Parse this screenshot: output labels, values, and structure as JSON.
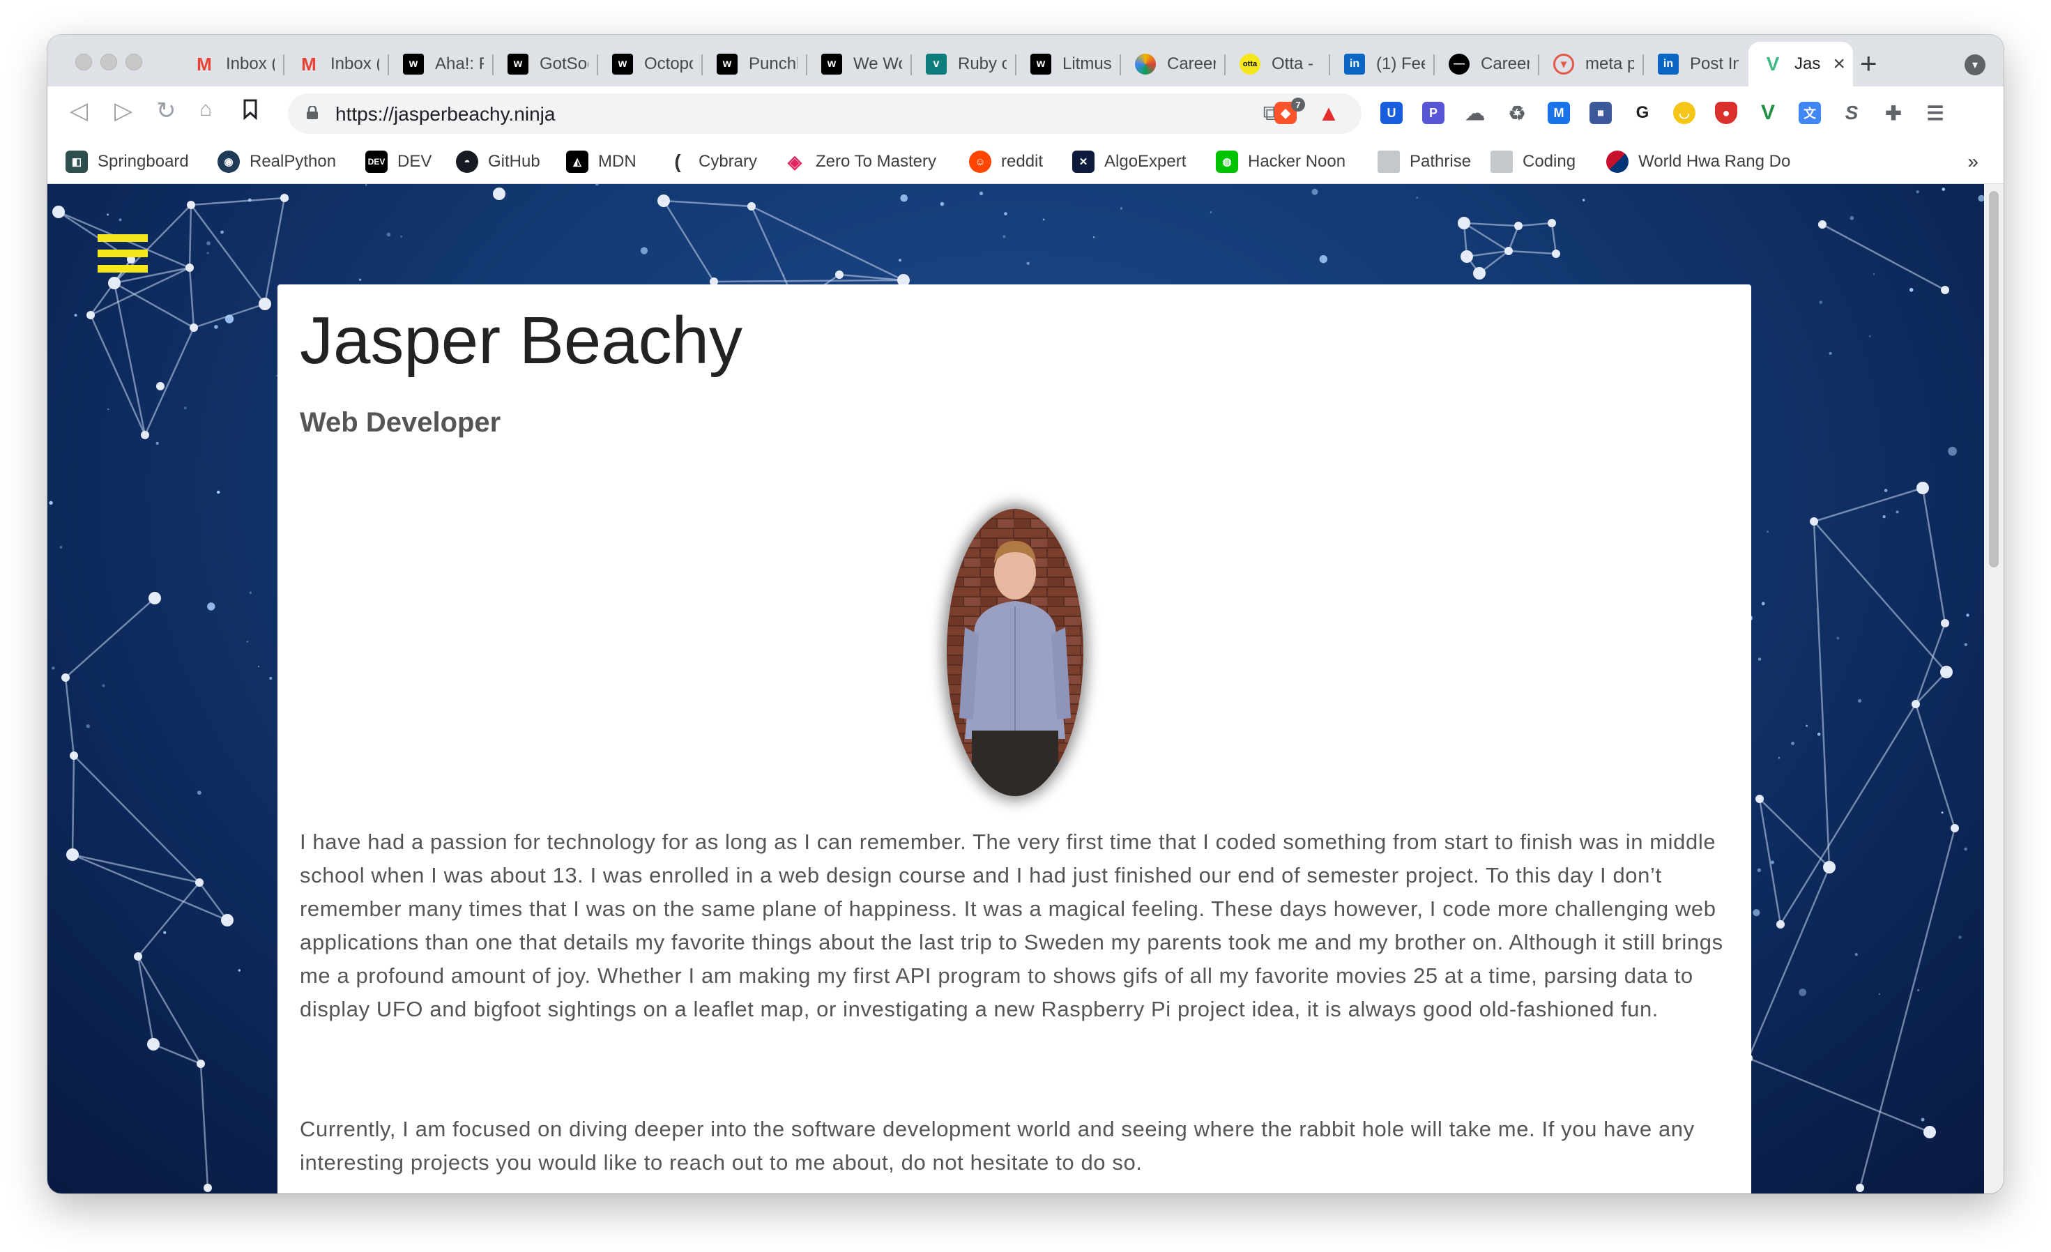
{
  "browser": {
    "tabs": [
      {
        "title": "Inbox (",
        "icon": "gmail-icon"
      },
      {
        "title": "Inbox (",
        "icon": "gmail-icon"
      },
      {
        "title": "Aha!: F",
        "icon": "wwr-icon"
      },
      {
        "title": "GotSoc",
        "icon": "wwr-icon"
      },
      {
        "title": "Octopo",
        "icon": "wwr-icon"
      },
      {
        "title": "Punchl",
        "icon": "wwr-icon"
      },
      {
        "title": "We Wo",
        "icon": "wwr-icon"
      },
      {
        "title": "Ruby o",
        "icon": "remote-icon"
      },
      {
        "title": "Litmus",
        "icon": "wwr-icon"
      },
      {
        "title": "Careers",
        "icon": "careers-icon"
      },
      {
        "title": "Otta -",
        "icon": "otta-icon"
      },
      {
        "title": "(1) Fee",
        "icon": "linkedin-icon"
      },
      {
        "title": "Career",
        "icon": "career-icon"
      },
      {
        "title": "meta p",
        "icon": "brave-icon"
      },
      {
        "title": "Post In",
        "icon": "linkedin-icon"
      },
      {
        "title": "Jas",
        "icon": "vue-icon"
      }
    ],
    "url": "https://jasperbeachy.ninja",
    "extension_badge": "7",
    "bookmarks": [
      {
        "label": "Springboard",
        "icon": "springboard-icon"
      },
      {
        "label": "RealPython",
        "icon": "realpython-icon"
      },
      {
        "label": "DEV",
        "icon": "dev-icon"
      },
      {
        "label": "GitHub",
        "icon": "github-icon"
      },
      {
        "label": "MDN",
        "icon": "mdn-icon"
      },
      {
        "label": "Cybrary",
        "icon": "cybrary-icon"
      },
      {
        "label": "Zero To Mastery",
        "icon": "ztm-icon"
      },
      {
        "label": "reddit",
        "icon": "reddit-icon"
      },
      {
        "label": "AlgoExpert",
        "icon": "algoexpert-icon"
      },
      {
        "label": "Hacker Noon",
        "icon": "hackernoon-icon"
      },
      {
        "label": "Pathrise",
        "icon": "folder-icon"
      },
      {
        "label": "Coding",
        "icon": "folder-icon"
      },
      {
        "label": "World Hwa Rang Do",
        "icon": "hwarangdo-icon"
      }
    ],
    "bookmarks_more": "»"
  },
  "page": {
    "name": "Jasper Beachy",
    "role": "Web Developer",
    "paragraphs": [
      "I have had a passion for technology for as long as I can remember. The very first time that I coded something from start to finish was in middle school when I was about 13. I was enrolled in a web design course and I had just finished our end of semester project. To this day I don’t remember many times that I was on the same plane of happiness. It was a magical feeling. These days however, I code more challenging web applications than one that details my favorite things about the last trip to Sweden my parents took me and my brother on. Although it still brings me a profound amount of joy. Whether I am making my first API program to shows gifs of all my favorite movies 25 at a time, parsing data to display UFO and bigfoot sightings on a leaflet map, or investigating a new Raspberry Pi project idea, it is always good old-fashioned fun.",
      "Currently, I am focused on diving deeper into the software development world and seeing where the rabbit hole will take me. If you have any interesting projects you would like to reach out to me about, do not hesitate to do so."
    ],
    "colors": {
      "menu_icon": "#f5e71c",
      "background": "#143a74",
      "card": "#ffffff"
    }
  }
}
